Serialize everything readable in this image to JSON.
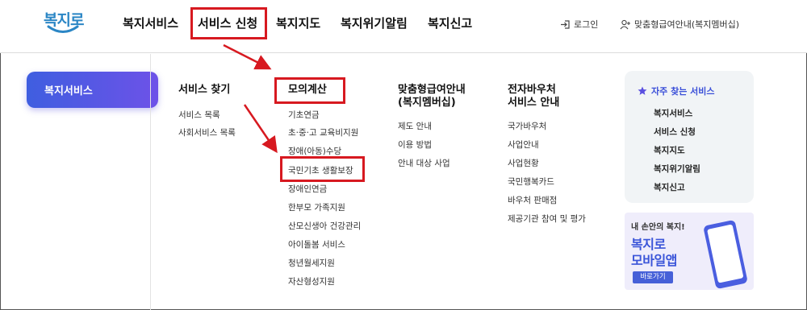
{
  "logo": {
    "text": "복지로"
  },
  "gnb": [
    {
      "label": "복지서비스"
    },
    {
      "label": "서비스 신청"
    },
    {
      "label": "복지지도"
    },
    {
      "label": "복지위기알림"
    },
    {
      "label": "복지신고"
    }
  ],
  "util": {
    "login": "로그인",
    "custom": "맞춤형급여안내(복지멤버십)"
  },
  "left_tab": {
    "label": "복지서비스"
  },
  "columns": [
    {
      "title": "서비스 찾기",
      "items": [
        "서비스 목록",
        "사회서비스 목록"
      ]
    },
    {
      "title": "모의계산",
      "items": [
        "기초연금",
        "초·중·고 교육비지원",
        "장애(아동)수당",
        "국민기초 생활보장",
        "장애인연금",
        "한부모 가족지원",
        "산모신생아 건강관리",
        "아이돌봄 서비스",
        "청년월세지원",
        "자산형성지원"
      ]
    },
    {
      "title_line1": "맞춤형급여안내",
      "title_line2": "(복지멤버십)",
      "items": [
        "제도 안내",
        "이용 방법",
        "안내 대상 사업"
      ]
    },
    {
      "title_line1": "전자바우처",
      "title_line2": "서비스 안내",
      "items": [
        "국가바우처",
        "사업안내",
        "사업현황",
        "국민행복카드",
        "바우처 판매점",
        "제공기관 참여 및 평가"
      ]
    }
  ],
  "favorites": {
    "title": "자주 찾는 서비스",
    "items": [
      "복지서비스",
      "서비스 신청",
      "복지지도",
      "복지위기알림",
      "복지신고"
    ]
  },
  "banner": {
    "top": "내 손안의 복지!",
    "line1": "복지로",
    "line2": "모바일앱",
    "button": "바로가기"
  },
  "colors": {
    "accent": "#3a4fd8",
    "highlight": "#d71920",
    "tab_gradient_start": "#3f5ee0",
    "tab_gradient_end": "#6d52e8"
  }
}
